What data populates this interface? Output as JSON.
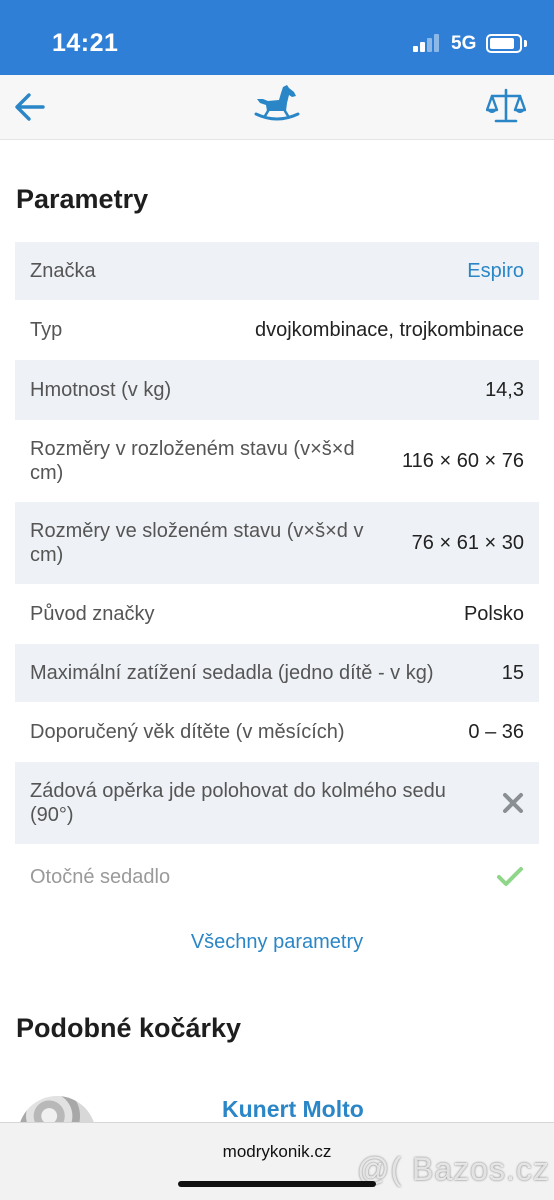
{
  "status_bar": {
    "time": "14:21",
    "network": "5G"
  },
  "nav": {
    "back_icon": "arrow-left-icon",
    "logo_icon": "rocking-horse-icon",
    "compare_icon": "scales-icon",
    "accent": "#2a86c6"
  },
  "section_title": "Parametry",
  "params": [
    {
      "label": "Značka",
      "value": "Espiro",
      "value_is_link": true,
      "shaded": true
    },
    {
      "label": "Typ",
      "value": "dvojkombinace, trojkombinace",
      "shaded": false
    },
    {
      "label": "Hmotnost (v kg)",
      "value": "14,3",
      "shaded": true
    },
    {
      "label": "Rozměry v rozloženém stavu (v×š×d cm)",
      "value": "116 × 60 × 76",
      "shaded": false
    },
    {
      "label": "Rozměry ve složeném stavu (v×š×d v cm)",
      "value": "76 × 61 × 30",
      "shaded": true
    },
    {
      "label": "Původ značky",
      "value": "Polsko",
      "shaded": false
    },
    {
      "label": "Maximální zatížení sedadla (jedno dítě - v kg)",
      "value": "15",
      "shaded": true
    },
    {
      "label": "Doporučený věk dítěte (v měsících)",
      "value": "0 – 36",
      "shaded": false
    },
    {
      "label": "Zádová opěrka jde polohovat do kolmého sedu (90°)",
      "icon": "cross-icon",
      "shaded": true
    },
    {
      "label": "Otočné sedadlo",
      "icon": "checkmark-icon",
      "shaded": false
    }
  ],
  "all_params_link": "Všechny parametry",
  "similar_title": "Podobné kočárky",
  "similar_items": [
    {
      "name": "Kunert Molto"
    }
  ],
  "browser": {
    "url": "modrykonik.cz"
  },
  "watermark": "@( Bazos.cz"
}
